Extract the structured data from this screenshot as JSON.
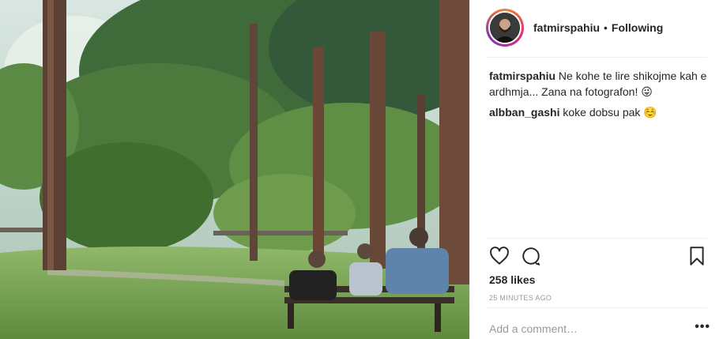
{
  "post": {
    "author": {
      "username": "fatmirspahiu",
      "separator": "•",
      "follow_status": "Following",
      "avatar_icon": "user-avatar"
    },
    "comments": [
      {
        "username": "fatmirspahiu",
        "text": "Ne kohe te lire shikojme kah e ardhmja... Zana na fotografon! 😜"
      },
      {
        "username": "albban_gashi",
        "text": "koke dobsu pak ☺️"
      }
    ],
    "actions": {
      "like_icon": "heart-icon",
      "comment_icon": "comment-icon",
      "save_icon": "bookmark-icon"
    },
    "likes": "258 likes",
    "timestamp": "25 MINUTES AGO",
    "add_comment": {
      "placeholder": "Add a comment…"
    },
    "more_label": "•••",
    "colors": {
      "text": "#262626",
      "muted": "#999999",
      "divider": "#efefef",
      "ring_start": "#f58529",
      "ring_mid": "#dd2a7b"
    }
  }
}
